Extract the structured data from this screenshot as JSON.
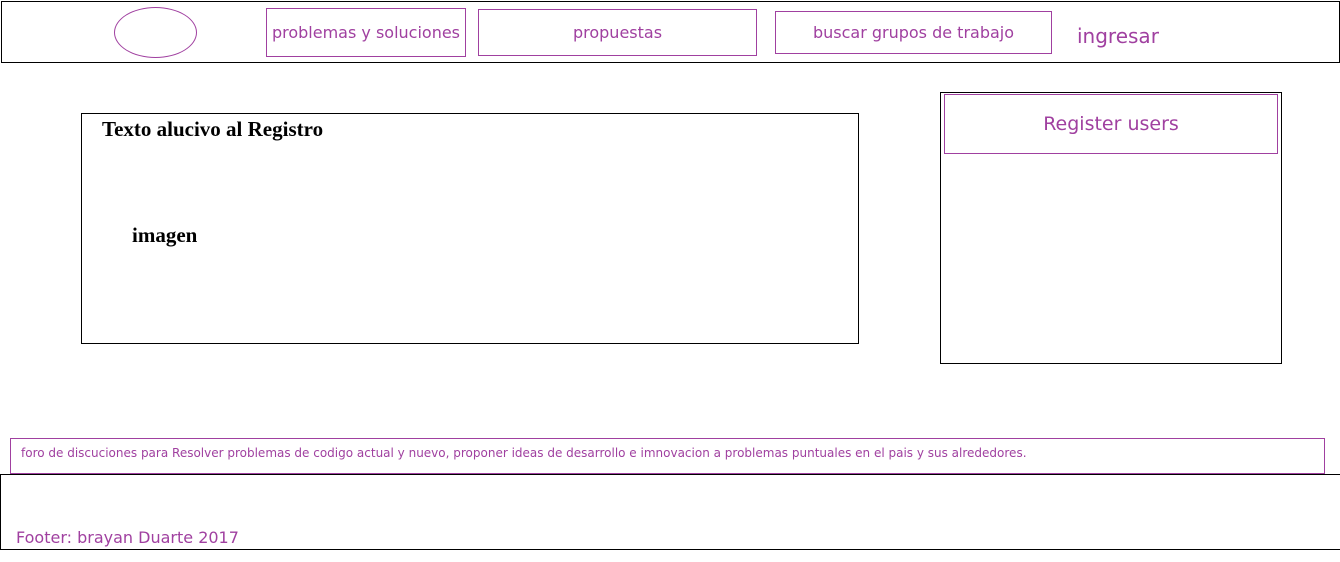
{
  "header": {
    "nav": [
      {
        "label": "problemas y soluciones"
      },
      {
        "label": "propuestas"
      },
      {
        "label": "buscar grupos de trabajo"
      }
    ],
    "login_label": "ingresar"
  },
  "main": {
    "title": "Texto alucivo al Registro",
    "image_placeholder": "imagen"
  },
  "register": {
    "button_label": "Register users"
  },
  "description": "foro de discuciones para Resolver  problemas de codigo actual y nuevo, proponer ideas de desarrollo e imnovacion a problemas puntuales en el pais y sus alrededores.",
  "footer": {
    "text": "Footer: brayan Duarte 2017"
  },
  "colors": {
    "accent": "#a040a0",
    "border": "#000000"
  }
}
